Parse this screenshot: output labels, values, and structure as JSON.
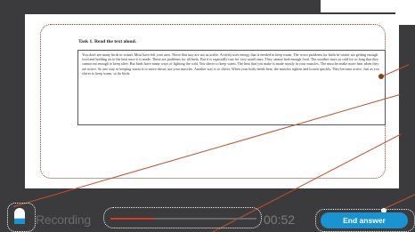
{
  "task": {
    "title": "Task 1. Read the text aloud.",
    "body": "You don't see many birds in winter. Most have left your area. Those that stay are not as active. Activity uses energy that is needed to keep warm. The worst problems for birds in winter are getting enough food and holding on to the heat once it is made. These are problems for all birds. But it is especially true for very small ones. They cannot find enough food. The weather stays so cold for so long that they cannot eat enough to keep alive. But birds have many ways of fighting the cold. You shiver to keep warm. The heat that you make is made mostly in your muscles. The muscles make more heat when they are active. So one way of keeping warm is to move about, use your muscles. Another way is to shiver. When your body needs heat, the muscles tighten and loosen quickly. They become active. Just as you shiver to keep warm, so do birds."
  },
  "recorder": {
    "status_label": "Recording",
    "time": "00:52",
    "progress": 0.3,
    "end_label": "End answer"
  },
  "colors": {
    "accent": "#1993d1",
    "annotation": "#c0502e",
    "progress": "#d23a2a",
    "background": "#3b3b3d"
  },
  "icons": {
    "mic": "microphone-icon"
  }
}
